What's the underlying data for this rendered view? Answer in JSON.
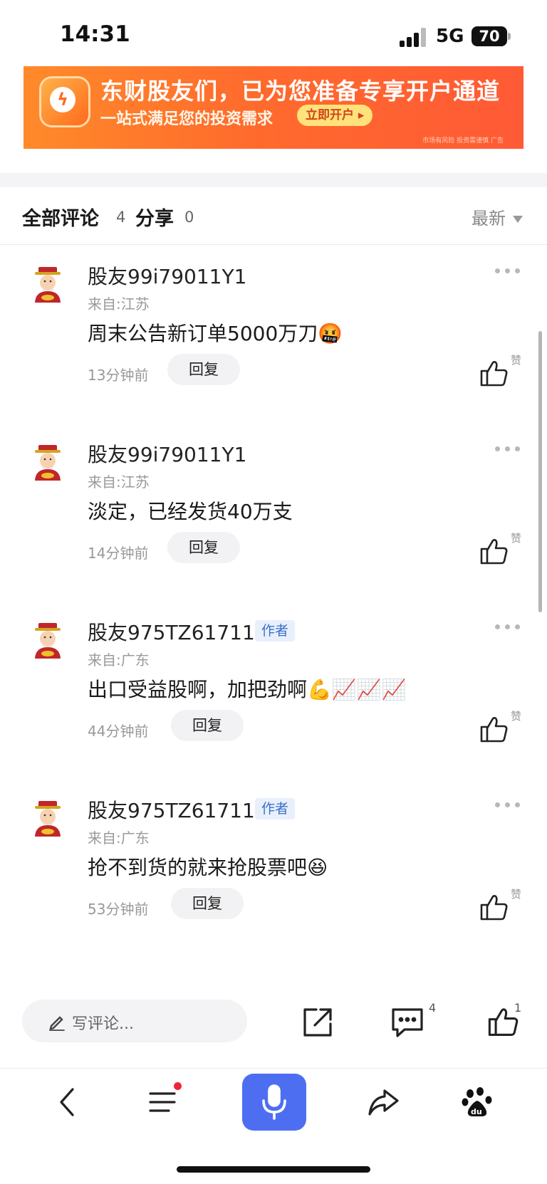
{
  "status_bar": {
    "time": "14:31",
    "network": "5G",
    "battery": "70"
  },
  "ad": {
    "title": "东财股友们，已为您准备专享开户通道",
    "subtitle": "一站式满足您的投资需求",
    "button": "立即开户 ▸",
    "disclaimer": "市场有风险 投资需谨慎 广告"
  },
  "tabs": {
    "all_comments_label": "全部评论",
    "all_comments_count": "4",
    "share_label": "分享",
    "share_count": "0",
    "sort_label": "最新"
  },
  "comments": [
    {
      "user": "股友99i79011Y1",
      "author": false,
      "location": "来自:江苏",
      "text": "周末公告新订单5000万刀🤬",
      "time": "13分钟前",
      "reply": "回复",
      "like_label": "赞"
    },
    {
      "user": "股友99i79011Y1",
      "author": false,
      "location": "来自:江苏",
      "text": "淡定，已经发货40万支",
      "time": "14分钟前",
      "reply": "回复",
      "like_label": "赞"
    },
    {
      "user": "股友975TZ61711",
      "author": true,
      "author_badge": "作者",
      "location": "来自:广东",
      "text": "出口受益股啊，加把劲啊💪📈📈📈",
      "time": "44分钟前",
      "reply": "回复",
      "like_label": "赞"
    },
    {
      "user": "股友975TZ61711",
      "author": true,
      "author_badge": "作者",
      "location": "来自:广东",
      "text": "抢不到货的就来抢股票吧😆",
      "time": "53分钟前",
      "reply": "回复",
      "like_label": "赞"
    }
  ],
  "action_bar": {
    "placeholder": "写评论...",
    "comment_count": "4",
    "like_count": "1"
  },
  "icons": {
    "ad_logo": "lightning-icon",
    "share": "share-out-icon",
    "comments": "comment-bubble-icon",
    "like": "thumbs-up-icon",
    "back": "back-arrow-icon",
    "menu": "menu-icon",
    "voice": "microphone-icon",
    "forward": "forward-share-icon",
    "baidu": "baidu-paw-icon"
  },
  "colors": {
    "accent": "#4e6ef2",
    "ad_orange": "#ff6b2c",
    "author_badge_bg": "#e8f0fc",
    "notification_dot": "#f0233c"
  }
}
